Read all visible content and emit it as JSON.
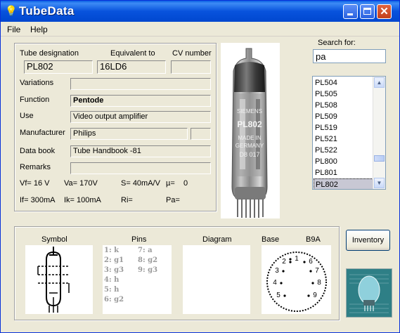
{
  "window": {
    "title": "TubeData"
  },
  "menu": {
    "file": "File",
    "help": "Help"
  },
  "labels": {
    "tube_designation": "Tube designation",
    "equivalent_to": "Equivalent to",
    "cv_number": "CV number",
    "variations": "Variations",
    "function": "Function",
    "use": "Use",
    "manufacturer": "Manufacturer",
    "data_book": "Data book",
    "remarks": "Remarks"
  },
  "fields": {
    "tube_designation": "PL802",
    "equivalent_to": "16LD6",
    "cv_number": "",
    "variations": "",
    "function": "Pentode",
    "use": "Video output amplifier",
    "manufacturer": "Philips",
    "manufacturer_extra": "",
    "data_book": "Tube Handbook -81",
    "remarks": ""
  },
  "params": {
    "vf": "Vf= 16 V",
    "va": "Va= 170V",
    "s": "S= 40mA/V",
    "mu": "µ=",
    "mu_value": "0",
    "if": "If= 300mA",
    "ik": "Ik= 100mA",
    "ri": "Ri=",
    "pa": "Pa="
  },
  "photo": {
    "tube_marking": [
      "SIEMENS",
      "PL802",
      "MADE IN",
      "GERMANY",
      "D8 017"
    ]
  },
  "search": {
    "label": "Search for:",
    "value": "pa"
  },
  "results": [
    "PL504",
    "PL505",
    "PL508",
    "PL509",
    "PL519",
    "PL521",
    "PL522",
    "PL800",
    "PL801",
    "PL802"
  ],
  "selected_result": "PL802",
  "bottom": {
    "symbol": "Symbol",
    "pins": "Pins",
    "diagram": "Diagram",
    "base": "Base",
    "base_type": "B9A",
    "pin_list": [
      "1: k",
      "2: g1",
      "3: g3",
      "4: h",
      "5: h",
      "6: g2",
      "7: a",
      "8: g2",
      "9: g3"
    ],
    "base_numbers": [
      "1",
      "2",
      "3",
      "4",
      "5",
      "6",
      "7",
      "8",
      "9"
    ]
  },
  "inventory_button": "Inventory",
  "colors": {
    "titlebar": "#0853dd",
    "window_bg": "#ece9d8",
    "pin_text": "#9a9a9a",
    "selected_row": "#c8c8d4"
  }
}
